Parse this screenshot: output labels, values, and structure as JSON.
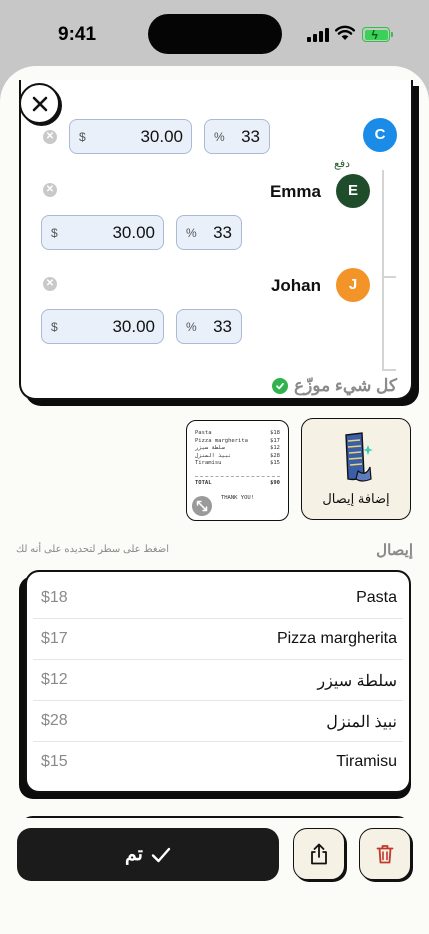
{
  "status_bar": {
    "time": "9:41"
  },
  "split": {
    "currency_symbol": "$",
    "percent_symbol": "%",
    "payer_label": "دفع",
    "distributed_label": "كل شيء موزّع",
    "people": [
      {
        "name": "",
        "initial": "C",
        "amount": "30.00",
        "percent": "33",
        "color": "#1a8ce8"
      },
      {
        "name": "Emma",
        "initial": "E",
        "amount": "30.00",
        "percent": "33",
        "color": "#1f4d2b"
      },
      {
        "name": "Johan",
        "initial": "J",
        "amount": "30.00",
        "percent": "33",
        "color": "#f29427"
      }
    ]
  },
  "receipt_thumb": {
    "lines": [
      {
        "name": "Pasta",
        "price": "$18"
      },
      {
        "name": "Pizza margherita",
        "price": "$17"
      },
      {
        "name": "سلطة سيزر",
        "price": "$12"
      },
      {
        "name": "نبيذ المنزل",
        "price": "$28"
      },
      {
        "name": "Tiramisu",
        "price": "$15"
      }
    ],
    "total_label": "TOTAL",
    "total_value": "$90",
    "thanks": "THANK YOU!"
  },
  "add_receipt": {
    "label": "إضافة إيصال"
  },
  "receipt_section": {
    "title": "إيصال",
    "hint": "اضغط على سطر لتحديده على أنه لك",
    "items": [
      {
        "name": "Pasta",
        "price": "$18"
      },
      {
        "name": "Pizza margherita",
        "price": "$17"
      },
      {
        "name": "سلطة سيزر",
        "price": "$12"
      },
      {
        "name": "نبيذ المنزل",
        "price": "$28"
      },
      {
        "name": "Tiramisu",
        "price": "$15"
      }
    ]
  },
  "actions": {
    "done_label": "تم"
  },
  "colors": {
    "accent_green": "#31b24e",
    "dark": "#1b1b1b",
    "cream": "#f6f1e5",
    "field_blue": "#e9f0fa"
  }
}
